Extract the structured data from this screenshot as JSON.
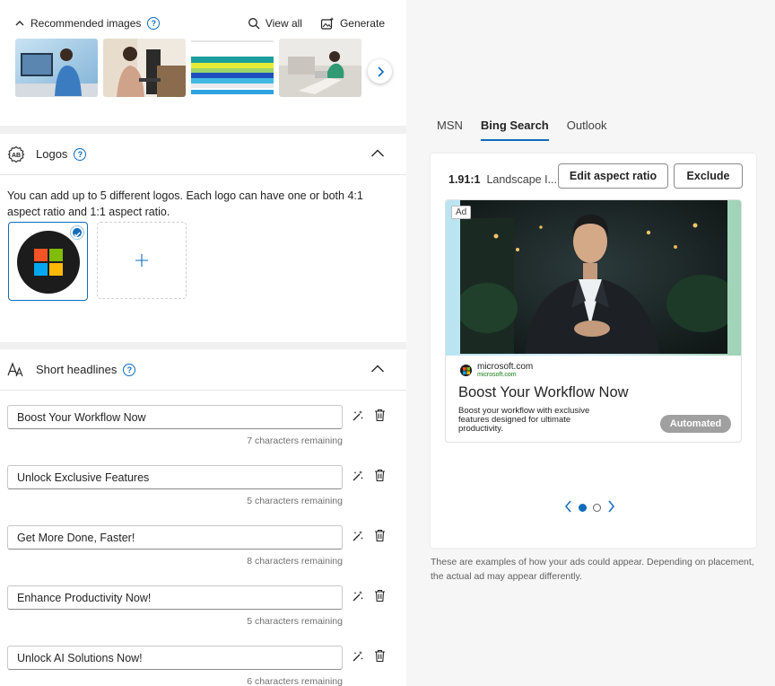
{
  "recommended": {
    "title": "Recommended images",
    "view_all": "View all",
    "generate": "Generate",
    "thumbnails": [
      "person-at-desktop-photo",
      "woman-with-laptop-photo",
      "colorful-stripes-image",
      "woman-on-couch-photo"
    ]
  },
  "logos": {
    "title": "Logos",
    "description": "You can add up to 5 different logos. Each logo can have one or both 4:1 aspect ratio and 1:1 aspect ratio."
  },
  "headlines": {
    "title": "Short headlines",
    "items": [
      {
        "value": "Boost Your Workflow Now",
        "remaining": "7 characters remaining"
      },
      {
        "value": "Unlock Exclusive Features",
        "remaining": "5 characters remaining"
      },
      {
        "value": "Get More Done, Faster!",
        "remaining": "8 characters remaining"
      },
      {
        "value": "Enhance Productivity Now!",
        "remaining": "5 characters remaining"
      },
      {
        "value": "Unlock AI Solutions Now!",
        "remaining": "6 characters remaining"
      }
    ]
  },
  "preview": {
    "tabs": [
      "MSN",
      "Bing Search",
      "Outlook"
    ],
    "active_tab": "Bing Search",
    "ratio": "1.91:1",
    "ratio_label": "Landscape I...",
    "edit_button": "Edit aspect ratio",
    "exclude_button": "Exclude",
    "ad": {
      "tag": "Ad",
      "domain": "microsoft.com",
      "domain_sub": "microsoft.com",
      "headline": "Boost Your Workflow Now",
      "description": "Boost your workflow with exclusive features designed for ultimate productivity.",
      "badge": "Automated"
    },
    "page_current": 1,
    "page_total": 2,
    "footnote": "These are examples of how your ads could appear. Depending on placement, the actual ad may appear differently."
  },
  "colors": {
    "accent": "#0f6cbd",
    "badge_gray": "#a0a0a0"
  }
}
